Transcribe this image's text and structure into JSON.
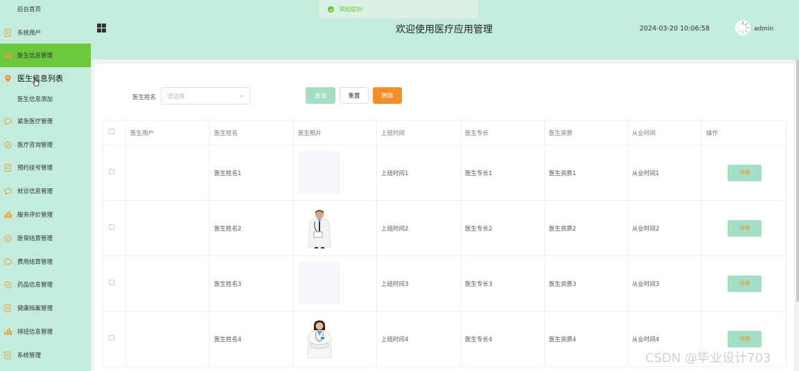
{
  "toast": {
    "message": "添加成功!"
  },
  "header": {
    "title": "欢迎使用医疗应用管理",
    "datetime": "2024-03-20 10:06:58",
    "username": "admin"
  },
  "sidebar": {
    "items": [
      {
        "label": "后台首页",
        "icon": "none"
      },
      {
        "label": "系统用户",
        "icon": "document-icon"
      },
      {
        "label": "医生信息管理",
        "icon": "bar-chart-icon",
        "active": true
      },
      {
        "label": "医生信息列表",
        "icon": "location-pin-icon",
        "current": true
      },
      {
        "label": "医生信息添加",
        "icon": "none"
      },
      {
        "label": "紧急医疗管理",
        "icon": "chat-icon"
      },
      {
        "label": "医疗咨询管理",
        "icon": "check-circle-icon"
      },
      {
        "label": "预约挂号管理",
        "icon": "document-icon"
      },
      {
        "label": "就诊信息管理",
        "icon": "chat-icon"
      },
      {
        "label": "服务评价管理",
        "icon": "bar-chart-icon"
      },
      {
        "label": "医保结算管理",
        "icon": "check-circle-icon"
      },
      {
        "label": "费用结算管理",
        "icon": "chat-icon"
      },
      {
        "label": "药品信息管理",
        "icon": "check-circle-icon"
      },
      {
        "label": "健康档案管理",
        "icon": "document-icon"
      },
      {
        "label": "排班信息管理",
        "icon": "bar-chart-icon"
      },
      {
        "label": "系统管理",
        "icon": "document-icon"
      }
    ]
  },
  "search": {
    "label": "医生姓名",
    "placeholder": "请选择",
    "query_label": "查询",
    "reset_label": "重置",
    "delete_label": "删除"
  },
  "table": {
    "columns": [
      "医生用户",
      "医生姓名",
      "医生照片",
      "上班时间",
      "医生专长",
      "医生资质",
      "从业时间",
      "操作"
    ],
    "rows": [
      {
        "user": "",
        "name": "医生姓名1",
        "photo": "placeholder",
        "shift": "上班时间1",
        "specialty": "医生专长1",
        "qualification": "医生资质1",
        "years": "从业时间1",
        "action": "详情"
      },
      {
        "user": "",
        "name": "医生姓名2",
        "photo": "male-doctor",
        "shift": "上班时间2",
        "specialty": "医生专长2",
        "qualification": "医生资质2",
        "years": "从业时间2",
        "action": "详情"
      },
      {
        "user": "",
        "name": "医生姓名3",
        "photo": "placeholder",
        "shift": "上班时间3",
        "specialty": "医生专长3",
        "qualification": "医生资质3",
        "years": "从业时间3",
        "action": "详情"
      },
      {
        "user": "",
        "name": "医生姓名4",
        "photo": "female-doctor",
        "shift": "上班时间4",
        "specialty": "医生专长4",
        "qualification": "医生资质4",
        "years": "从业时间4",
        "action": "详情"
      }
    ]
  },
  "watermark": "CSDN @毕业设计703",
  "colors": {
    "sidebar_bg": "#c3ecdc",
    "active_item": "#6cc73c",
    "query_button": "#a3dfc3",
    "delete_button": "#f78c2a",
    "toast_text": "#67c23a"
  }
}
